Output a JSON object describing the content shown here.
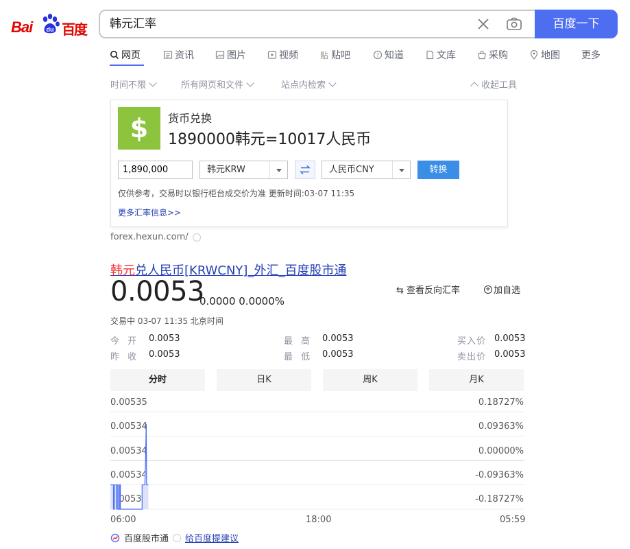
{
  "header": {
    "logo_bai": "Bai",
    "logo_cn": "百度",
    "query": "韩元汇率",
    "search_button": "百度一下"
  },
  "tabs": [
    {
      "label": "网页",
      "icon": "search-icon",
      "active": true
    },
    {
      "label": "资讯",
      "icon": "news-icon"
    },
    {
      "label": "图片",
      "icon": "image-icon"
    },
    {
      "label": "视频",
      "icon": "video-icon"
    },
    {
      "label": "贴吧",
      "icon": "tieba-icon"
    },
    {
      "label": "知道",
      "icon": "question-icon"
    },
    {
      "label": "文库",
      "icon": "document-icon"
    },
    {
      "label": "采购",
      "icon": "shop-icon"
    },
    {
      "label": "地图",
      "icon": "map-icon"
    },
    {
      "label": "更多",
      "icon": ""
    }
  ],
  "filters": {
    "time": "时间不限",
    "type": "所有网页和文件",
    "site": "站点内检索",
    "collapse": "收起工具"
  },
  "converter": {
    "title": "货币兑换",
    "result": "1890000韩元=10017人民币",
    "amount": "1,890,000",
    "from_currency": "韩元KRW",
    "to_currency": "人民币CNY",
    "convert_button": "转换",
    "note": "仅供参考，交易时以银行柜台成交价为准 更新时间:03-07 11:35",
    "more_link": "更多汇率信息>>",
    "source": "forex.hexun.com/",
    "tile_symbol": "$",
    "tile_color": "#8cc43e"
  },
  "stock": {
    "title_highlight": "韩元",
    "title_rest": "兑人民币[KRWCNY]_外汇_百度股市通",
    "reverse_label": "查看反向汇率",
    "add_watch_label": "加自选",
    "price": "0.0053",
    "change": "0.0000 0.0000%",
    "status": "交易中  03-07 11:35  北京时间",
    "stats": {
      "open_label": "今 开",
      "open": "0.0053",
      "prev_close_label": "昨 收",
      "prev_close": "0.0053",
      "high_label": "最 高",
      "high": "0.0053",
      "low_label": "最 低",
      "low": "0.0053",
      "bid_label": "买入价",
      "bid": "0.0053",
      "ask_label": "卖出价",
      "ask": "0.0053"
    },
    "chart_tabs": [
      "分时",
      "日K",
      "周K",
      "月K"
    ],
    "active_chart_tab": 0
  },
  "chart_data": {
    "type": "area",
    "title": "",
    "xlabel": "",
    "ylabel": "",
    "x_ticks": [
      "06:00",
      "18:00",
      "05:59"
    ],
    "y_ticks_left": [
      "0.00535",
      "0.00534",
      "0.00534",
      "0.00534",
      "0.00533"
    ],
    "y_ticks_right": [
      "0.18727%",
      "0.09363%",
      "0.00000%",
      "-0.09363%",
      "-0.18727%"
    ],
    "ylim": [
      -0.18727,
      0.18727
    ],
    "x_range": [
      0,
      24
    ],
    "points_pct": [
      [
        0.0,
        -0.09363
      ],
      [
        0.18,
        -0.09363
      ],
      [
        0.18,
        -0.18727
      ],
      [
        0.24,
        -0.18727
      ],
      [
        0.24,
        -0.09363
      ],
      [
        0.36,
        -0.09363
      ],
      [
        0.36,
        -0.18727
      ],
      [
        0.4,
        -0.18727
      ],
      [
        0.4,
        -0.09363
      ],
      [
        0.46,
        -0.09363
      ],
      [
        0.46,
        -0.18727
      ],
      [
        0.54,
        -0.18727
      ],
      [
        0.54,
        -0.09363
      ],
      [
        0.58,
        -0.09363
      ],
      [
        0.58,
        -0.18727
      ],
      [
        1.84,
        -0.18727
      ],
      [
        1.84,
        -0.09363
      ],
      [
        2.0,
        -0.09363
      ],
      [
        2.04,
        0.0
      ],
      [
        2.08,
        0.14045
      ],
      [
        2.1,
        -0.09363
      ],
      [
        2.2,
        -0.09363
      ]
    ],
    "line_color": "#4e6ef2",
    "fill_color": "#dbe4fb",
    "grid": true
  },
  "footer": {
    "brand": "百度股市通",
    "feedback": "给百度提建议"
  }
}
